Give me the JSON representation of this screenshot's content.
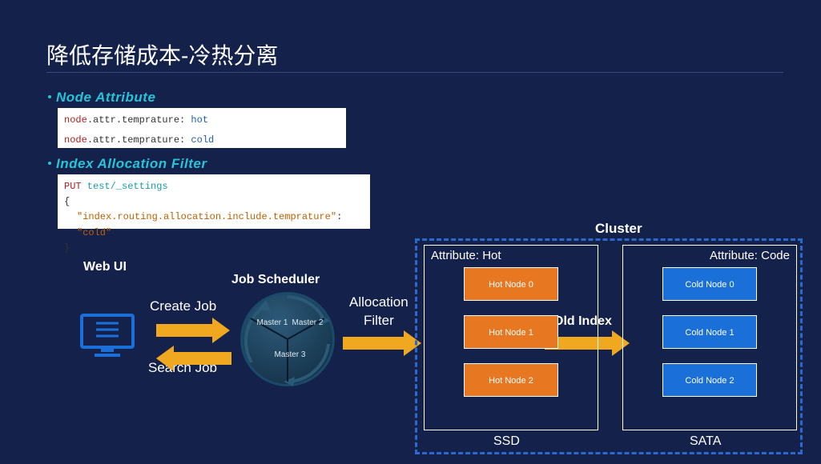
{
  "title": "降低存储成本-冷热分离",
  "sections": {
    "node_attribute": {
      "heading": "Node Attribute",
      "code_prefix": "node",
      "code_attr": ".attr.temprature:",
      "code_val_hot": " hot",
      "code_val_cold": " cold"
    },
    "index_allocation": {
      "heading": "Index Allocation Filter",
      "http_method": "PUT",
      "http_path": " test/_settings",
      "json_open": "{",
      "json_key": "\"index.routing.allocation.include.temprature\"",
      "json_colon": ": ",
      "json_val": "\"cold\"",
      "json_close": "}"
    }
  },
  "diagram": {
    "web_ui": "Web UI",
    "create_job": "Create Job",
    "search_job": "Search Job",
    "job_scheduler": "Job Scheduler",
    "masters": [
      "Master 1",
      "Master 2",
      "Master 3"
    ],
    "allocation_filter_l1": "Allocation",
    "allocation_filter_l2": "Filter",
    "old_index": "Old Index",
    "cluster": "Cluster",
    "hot_group_label": "Attribute: Hot",
    "cold_group_label": "Attribute: Code",
    "hot_nodes": [
      "Hot Node 0",
      "Hot Node 1",
      "Hot Node 2"
    ],
    "cold_nodes": [
      "Cold Node 0",
      "Cold Node 1",
      "Cold Node 2"
    ],
    "hot_storage": "SSD",
    "cold_storage": "SATA"
  }
}
